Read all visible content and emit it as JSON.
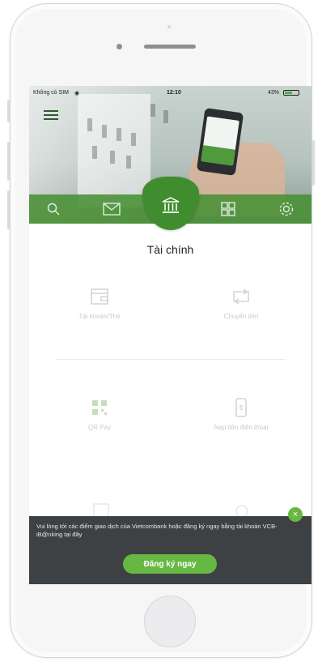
{
  "status_bar": {
    "carrier": "Không có SIM",
    "time": "12:10",
    "battery_text": "43%"
  },
  "hero": {
    "nav_icons": [
      "search-icon",
      "mail-icon",
      "bank-icon",
      "grid-icon",
      "gear-icon"
    ],
    "accent_color": "#488f34"
  },
  "main": {
    "section_title": "Tài chính",
    "tiles": [
      {
        "label": "Tài khoản/Thẻ",
        "icon": "wallet-icon"
      },
      {
        "label": "Chuyển tiền",
        "icon": "transfer-icon"
      },
      {
        "label": "QR Pay",
        "icon": "qr-icon"
      },
      {
        "label": "Nạp tiền điện thoại",
        "icon": "phone-topup-icon"
      }
    ]
  },
  "banner": {
    "message": "Vui lòng tới các điểm giao dịch của Vietcombank hoặc đăng ký ngay bằng tài khoản VCB-iB@nking tại đây",
    "cta_label": "Đăng ký ngay",
    "close_symbol": "×",
    "cta_color": "#66b842"
  }
}
